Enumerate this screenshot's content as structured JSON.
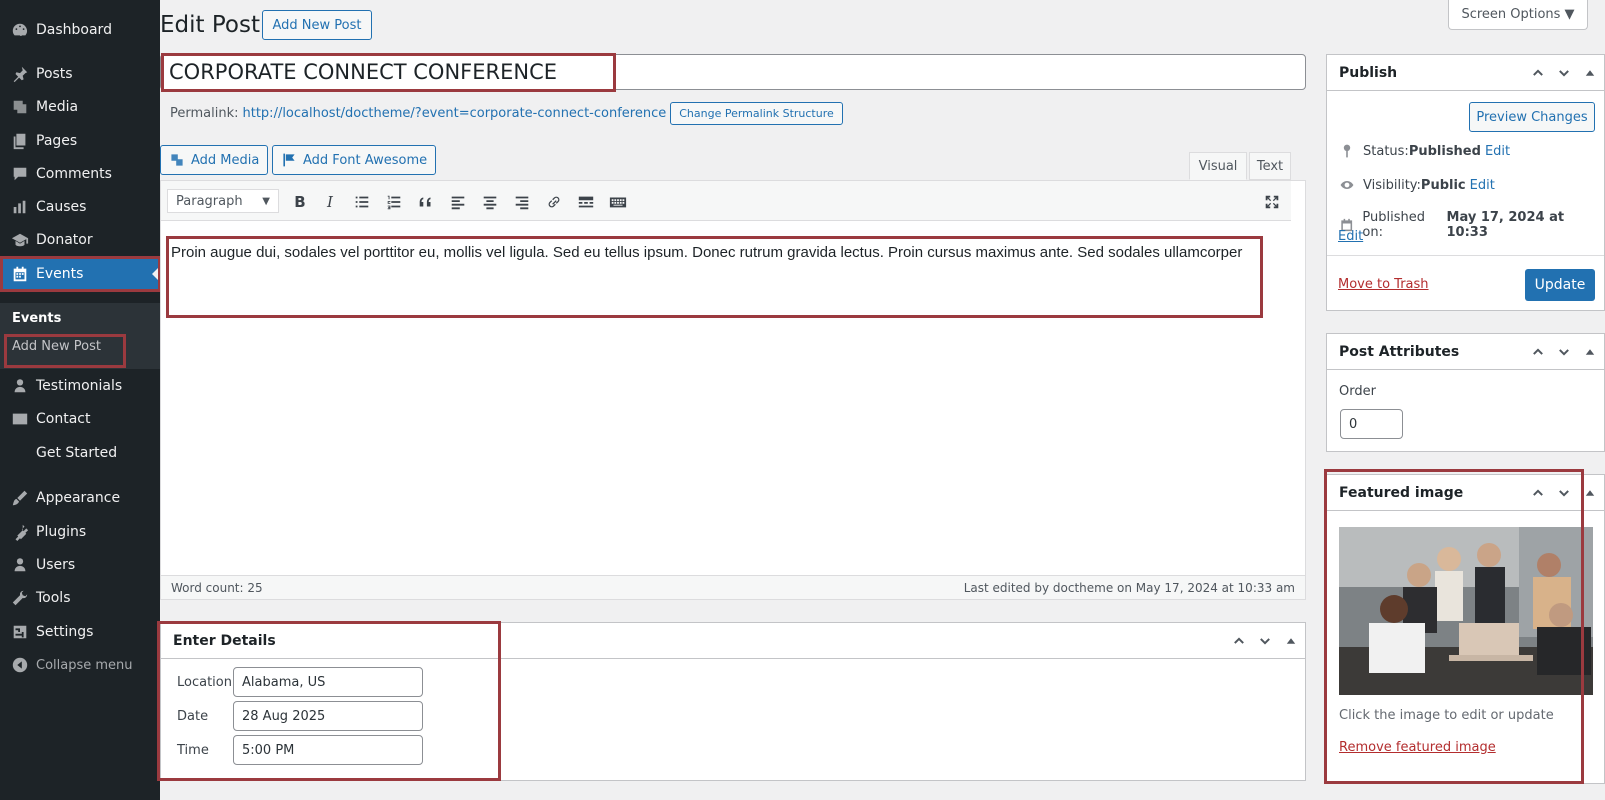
{
  "sidebar": {
    "items": [
      {
        "label": "Dashboard",
        "icon": "dashboard-icon"
      },
      {
        "label": "Posts",
        "icon": "pin-icon"
      },
      {
        "label": "Media",
        "icon": "media-icon"
      },
      {
        "label": "Pages",
        "icon": "pages-icon"
      },
      {
        "label": "Comments",
        "icon": "comment-icon"
      },
      {
        "label": "Causes",
        "icon": "chart-bar-icon"
      },
      {
        "label": "Donator",
        "icon": "graduation-cap-icon"
      },
      {
        "label": "Events",
        "icon": "calendar-icon"
      },
      {
        "label": "Testimonials",
        "icon": "person-icon"
      },
      {
        "label": "Contact",
        "icon": "envelope-icon"
      },
      {
        "label": "Get Started",
        "icon": ""
      },
      {
        "label": "Appearance",
        "icon": "paintbrush-icon"
      },
      {
        "label": "Plugins",
        "icon": "plug-icon"
      },
      {
        "label": "Users",
        "icon": "users-icon"
      },
      {
        "label": "Tools",
        "icon": "wrench-icon"
      },
      {
        "label": "Settings",
        "icon": "settings-icon"
      }
    ],
    "submenu": {
      "title": "Events",
      "item": "Add New Post"
    },
    "collapse": "Collapse menu"
  },
  "header": {
    "title": "Edit Post",
    "add_new": "Add New Post",
    "screen_options": "Screen Options ▼"
  },
  "post": {
    "title": "CORPORATE CONNECT CONFERENCE",
    "permalink_label": "Permalink:",
    "permalink_url": "http://localhost/doctheme/?event=corporate-connect-conference",
    "change_permalink": "Change Permalink Structure"
  },
  "editor": {
    "add_media": "Add Media",
    "add_font_awesome": "Add Font Awesome",
    "tab_visual": "Visual",
    "tab_text": "Text",
    "format": "Paragraph",
    "content": "Proin augue dui, sodales vel porttitor eu, mollis vel ligula. Sed eu tellus ipsum. Donec rutrum gravida lectus. Proin cursus maximus ante. Sed sodales ullamcorper",
    "word_count": "Word count: 25",
    "last_edited": "Last edited by doctheme on May 17, 2024 at 10:33 am"
  },
  "details": {
    "title": "Enter Details",
    "location_label": "Location",
    "location_value": "Alabama, US",
    "date_label": "Date",
    "date_value": "28 Aug 2025",
    "time_label": "Time",
    "time_value": "5:00 PM"
  },
  "publish": {
    "title": "Publish",
    "preview": "Preview Changes",
    "status_label": "Status: ",
    "status_value": "Published",
    "visibility_label": "Visibility: ",
    "visibility_value": "Public",
    "published_label": "Published on: ",
    "published_value": "May 17, 2024 at 10:33",
    "edit": "Edit",
    "trash": "Move to Trash",
    "update": "Update"
  },
  "attributes": {
    "title": "Post Attributes",
    "order_label": "Order",
    "order_value": "0"
  },
  "featured": {
    "title": "Featured image",
    "hint": "Click the image to edit or update",
    "remove": "Remove featured image"
  },
  "colors": {
    "sidebar_bg": "#1d2327",
    "accent": "#2271b1",
    "highlight": "#9b3a3f",
    "danger": "#b32d2e"
  }
}
